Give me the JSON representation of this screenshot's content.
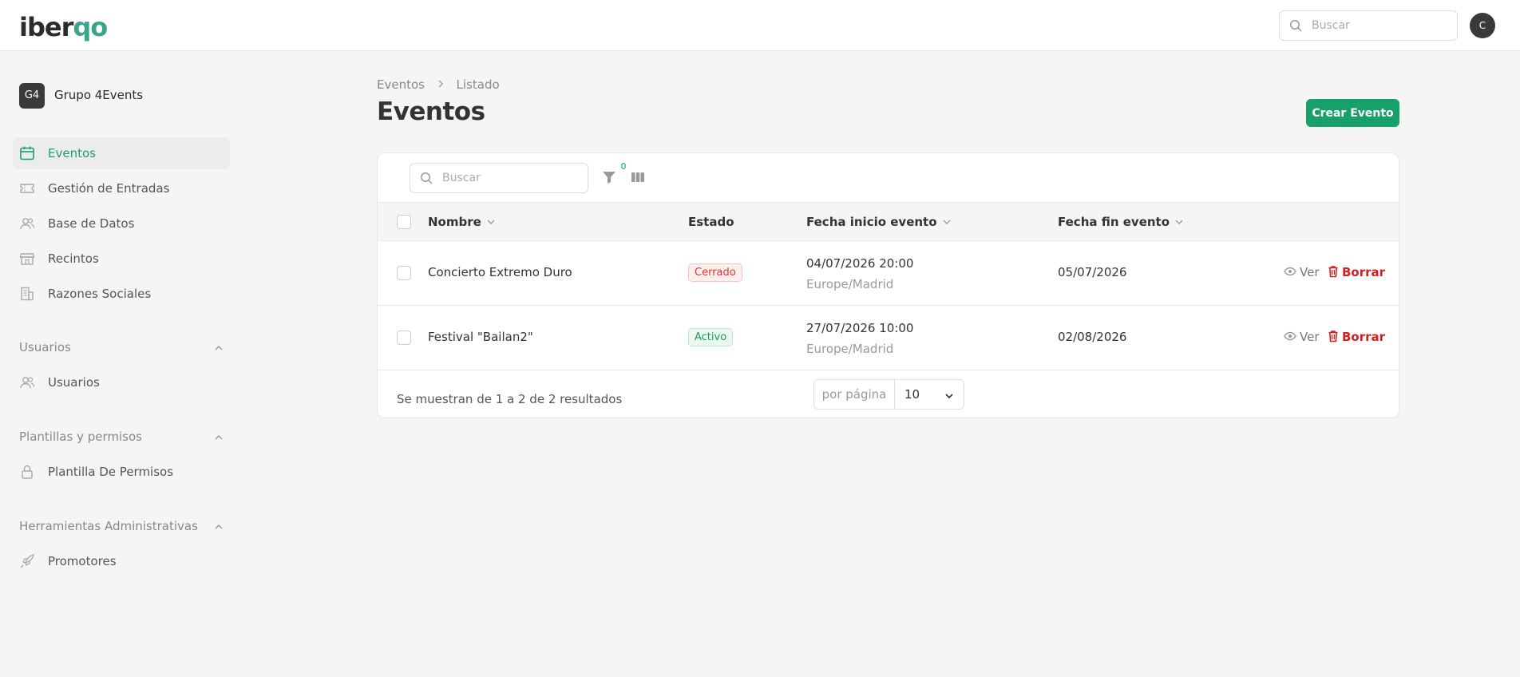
{
  "header": {
    "logo_part1": "iber",
    "logo_part2": "qo",
    "search_placeholder": "Buscar",
    "avatar_initial": "C"
  },
  "sidebar": {
    "org_badge": "G4",
    "org_name": "Grupo 4Events",
    "items": [
      {
        "label": "Eventos",
        "icon": "calendar-icon",
        "active": true
      },
      {
        "label": "Gestión de Entradas",
        "icon": "ticket-icon"
      },
      {
        "label": "Base de Datos",
        "icon": "users-icon"
      },
      {
        "label": "Recintos",
        "icon": "store-icon"
      },
      {
        "label": "Razones Sociales",
        "icon": "building-icon"
      }
    ],
    "sections": [
      {
        "label": "Usuarios",
        "items": [
          {
            "label": "Usuarios",
            "icon": "users-icon"
          }
        ]
      },
      {
        "label": "Plantillas y permisos",
        "items": [
          {
            "label": "Plantilla De Permisos",
            "icon": "lock-icon"
          }
        ]
      },
      {
        "label": "Herramientas Administrativas",
        "items": [
          {
            "label": "Promotores",
            "icon": "rocket-icon"
          }
        ]
      }
    ]
  },
  "main": {
    "breadcrumb": [
      "Eventos",
      "Listado"
    ],
    "title": "Eventos",
    "create_button": "Crear Evento",
    "table": {
      "search_placeholder": "Buscar",
      "filter_count": "0",
      "columns": [
        "Nombre",
        "Estado",
        "Fecha inicio evento",
        "Fecha fin evento"
      ],
      "rows": [
        {
          "nombre": "Concierto Extremo Duro",
          "estado": "Cerrado",
          "inicio": "04/07/2026 20:00",
          "zona": "Europe/Madrid",
          "fin": "05/07/2026"
        },
        {
          "nombre": "Festival \"Bailan2\"",
          "estado": "Activo",
          "inicio": "27/07/2026 10:00",
          "zona": "Europe/Madrid",
          "fin": "02/08/2026"
        }
      ],
      "actions": {
        "view": "Ver",
        "delete": "Borrar"
      },
      "footer_text": "Se muestran de 1 a 2 de 2 resultados",
      "per_page_label": "por página",
      "per_page_value": "10"
    }
  },
  "colors": {
    "accent": "#17a06b",
    "danger": "#d41f1f",
    "logo_accent": "#3aa58a"
  }
}
